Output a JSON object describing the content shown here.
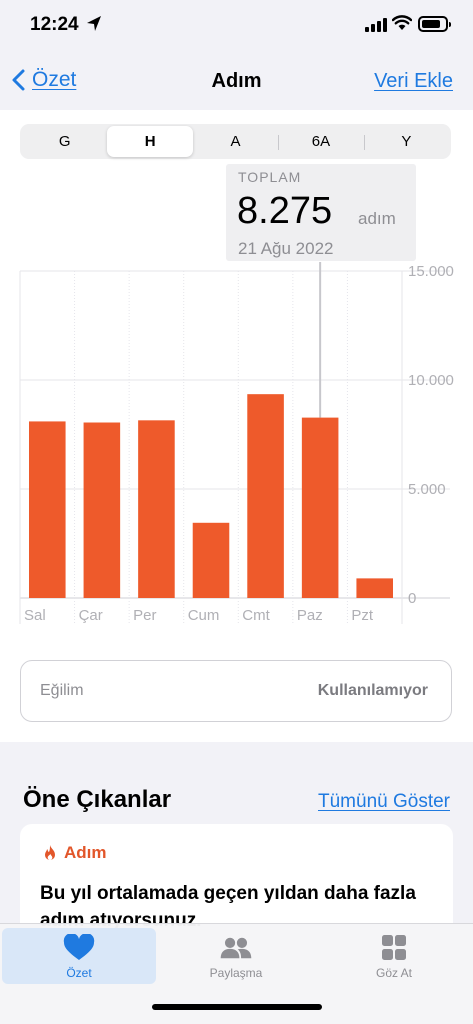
{
  "status": {
    "time": "12:24"
  },
  "nav": {
    "back_label": "Özet",
    "title": "Adım",
    "action_label": "Veri Ekle"
  },
  "segments": [
    {
      "label": "G",
      "active": false
    },
    {
      "label": "H",
      "active": true
    },
    {
      "label": "A",
      "active": false
    },
    {
      "label": "6A",
      "active": false
    },
    {
      "label": "Y",
      "active": false
    }
  ],
  "tooltip": {
    "label": "TOPLAM",
    "value": "8.275",
    "unit": "adım",
    "date": "21 Ağu 2022"
  },
  "chart_data": {
    "type": "bar",
    "categories": [
      "Sal",
      "Çar",
      "Per",
      "Cum",
      "Cmt",
      "Paz",
      "Pzt"
    ],
    "values": [
      8100,
      8050,
      8150,
      3450,
      9350,
      8275,
      900
    ],
    "yticks": [
      "15.000",
      "10.000",
      "5.000",
      "0"
    ],
    "ylim": [
      0,
      15000
    ],
    "bar_color": "#ee5a2b",
    "highlight_index": 5,
    "grid": true
  },
  "trend": {
    "label": "Eğilim",
    "value": "Kullanılamıyor"
  },
  "highlights": {
    "header": "Öne Çıkanlar",
    "link_label": "Tümünü Göster",
    "card_title": "Adım",
    "card_text": "Bu yıl ortalamada geçen yıldan daha fazla adım atıyorsunuz."
  },
  "tabs": [
    {
      "label": "Özet",
      "icon": "heart-icon",
      "active": true
    },
    {
      "label": "Paylaşma",
      "icon": "people-icon",
      "active": false
    },
    {
      "label": "Göz At",
      "icon": "grid-icon",
      "active": false
    }
  ],
  "colors": {
    "accent": "#1f7ae0",
    "bar": "#ee5a2b"
  }
}
